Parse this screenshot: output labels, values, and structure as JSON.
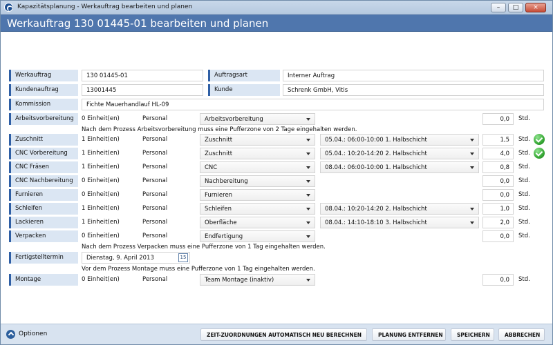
{
  "window": {
    "title": "Kapazitätsplanung - Werkauftrag bearbeiten und planen",
    "min_icon": "minimize-icon",
    "max_icon": "maximize-icon",
    "close_icon": "close-icon",
    "min_glyph": "–",
    "max_glyph": "□",
    "close_glyph": "×"
  },
  "header": {
    "title": "Werkauftrag 130 01445-01 bearbeiten und planen"
  },
  "fields": {
    "werkauftrag_label": "Werkauftrag",
    "werkauftrag_value": "130 01445-01",
    "auftragsart_label": "Auftragsart",
    "auftragsart_value": "Interner Auftrag",
    "kundenauftrag_label": "Kundenauftrag",
    "kundenauftrag_value": "13001445",
    "kunde_label": "Kunde",
    "kunde_value": "Schrenk GmbH, Vitis",
    "kommission_label": "Kommission",
    "kommission_value": "Fichte Mauerhandlauf HL-09"
  },
  "personal_label": "Personal",
  "unit_label": "Std.",
  "rows": [
    {
      "label": "Arbeitsvorbereitung",
      "units": "0 Einheit(en)",
      "select": "Arbeitsvorbereitung",
      "slot": "",
      "value": "0,0",
      "check": false
    },
    {
      "label": "Zuschnitt",
      "units": "1 Einheit(en)",
      "select": "Zuschnitt",
      "slot": "05.04.: 06:00-10:00 1. Halbschicht",
      "value": "1,5",
      "check": true
    },
    {
      "label": "CNC Vorbereitung",
      "units": "1 Einheit(en)",
      "select": "Zuschnitt",
      "slot": "05.04.: 10:20-14:20 2. Halbschicht",
      "value": "4,0",
      "check": true
    },
    {
      "label": "CNC Fräsen",
      "units": "1 Einheit(en)",
      "select": "CNC",
      "slot": "08.04.: 06:00-10:00 1. Halbschicht",
      "value": "0,8",
      "check": false
    },
    {
      "label": "CNC Nachbereitung",
      "units": "0 Einheit(en)",
      "select": "Nachbereitung",
      "slot": "",
      "value": "0,0",
      "check": false
    },
    {
      "label": "Furnieren",
      "units": "0 Einheit(en)",
      "select": "Furnieren",
      "slot": "",
      "value": "0,0",
      "check": false
    },
    {
      "label": "Schleifen",
      "units": "1 Einheit(en)",
      "select": "Schleifen",
      "slot": "08.04.: 10:20-14:20 2. Halbschicht",
      "value": "1,0",
      "check": false
    },
    {
      "label": "Lackieren",
      "units": "1 Einheit(en)",
      "select": "Oberfläche",
      "slot": "08.04.: 14:10-18:10 3. Halbschicht",
      "value": "2,0",
      "check": false
    },
    {
      "label": "Verpacken",
      "units": "0 Einheit(en)",
      "select": "Endfertigung",
      "slot": "",
      "value": "0,0",
      "check": false
    },
    {
      "label": "Montage",
      "units": "0 Einheit(en)",
      "select": "Team Montage (inaktiv)",
      "slot": "",
      "value": "0,0",
      "check": false
    }
  ],
  "notes": {
    "after_arbeitsvorbereitung": "Nach dem Prozess Arbeitsvorbereitung muss eine Pufferzone von 2 Tage eingehalten werden.",
    "after_verpacken": "Nach dem Prozess Verpacken muss eine Pufferzone von 1 Tag eingehalten werden.",
    "before_montage": "Vor dem Prozess Montage muss eine Pufferzone von 1 Tag eingehalten werden."
  },
  "fertigstellung": {
    "label": "Fertigstelltermin",
    "value": "Dienstag, 9. April 2013",
    "calendar_day": "15",
    "calendar_icon": "calendar-icon"
  },
  "footer": {
    "options_label": "Optionen",
    "options_icon": "chevron-up-icon",
    "buttons": {
      "recalc": "ZEIT-ZUORDNUNGEN AUTOMATISCH NEU BERECHNEN",
      "remove": "PLANUNG ENTFERNEN",
      "save": "SPEICHERN",
      "cancel": "ABBRECHEN"
    }
  }
}
